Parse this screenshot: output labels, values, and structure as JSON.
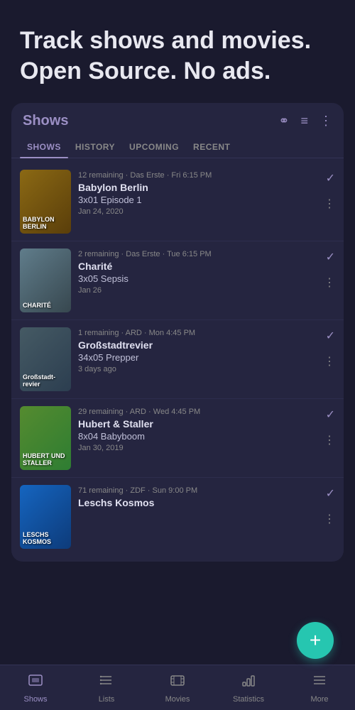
{
  "hero": {
    "title": "Track shows and movies. Open Source. No ads."
  },
  "card": {
    "title": "Shows",
    "tabs": [
      {
        "label": "SHOWS",
        "active": true
      },
      {
        "label": "HISTORY",
        "active": false
      },
      {
        "label": "UPCOMING",
        "active": false
      },
      {
        "label": "RECENT",
        "active": false
      }
    ],
    "shows": [
      {
        "id": 1,
        "poster_class": "poster-babylon",
        "poster_label": "BABYLON BERLIN",
        "remaining": "12 remaining",
        "channel": "Das Erste",
        "time": "Fri 6:15 PM",
        "name": "Babylon Berlin",
        "episode": "3x01 Episode 1",
        "date": "Jan 24, 2020"
      },
      {
        "id": 2,
        "poster_class": "poster-charite",
        "poster_label": "CHARITÉ",
        "remaining": "2 remaining",
        "channel": "Das Erste",
        "time": "Tue 6:15 PM",
        "name": "Charité",
        "episode": "3x05 Sepsis",
        "date": "Jan 26"
      },
      {
        "id": 3,
        "poster_class": "poster-gross",
        "poster_label": "Großstadt-revier",
        "remaining": "1 remaining",
        "channel": "ARD",
        "time": "Mon 4:45 PM",
        "name": "Großstadtrevier",
        "episode": "34x05 Prepper",
        "date": "3 days ago"
      },
      {
        "id": 4,
        "poster_class": "poster-hubert",
        "poster_label": "HUBERT UND STALLER",
        "remaining": "29 remaining",
        "channel": "ARD",
        "time": "Wed 4:45 PM",
        "name": "Hubert & Staller",
        "episode": "8x04 Babyboom",
        "date": "Jan 30, 2019"
      },
      {
        "id": 5,
        "poster_class": "poster-leschs",
        "poster_label": "LESCHS KOSMOS",
        "remaining": "71 remaining",
        "channel": "ZDF",
        "time": "Sun 9:00 PM",
        "name": "Leschs Kosmos",
        "episode": "",
        "date": ""
      }
    ]
  },
  "fab": {
    "label": "+"
  },
  "bottom_nav": {
    "items": [
      {
        "label": "Shows",
        "active": true,
        "icon": "shows"
      },
      {
        "label": "Lists",
        "active": false,
        "icon": "lists"
      },
      {
        "label": "Movies",
        "active": false,
        "icon": "movies"
      },
      {
        "label": "Statistics",
        "active": false,
        "icon": "stats"
      },
      {
        "label": "More",
        "active": false,
        "icon": "more"
      }
    ]
  }
}
